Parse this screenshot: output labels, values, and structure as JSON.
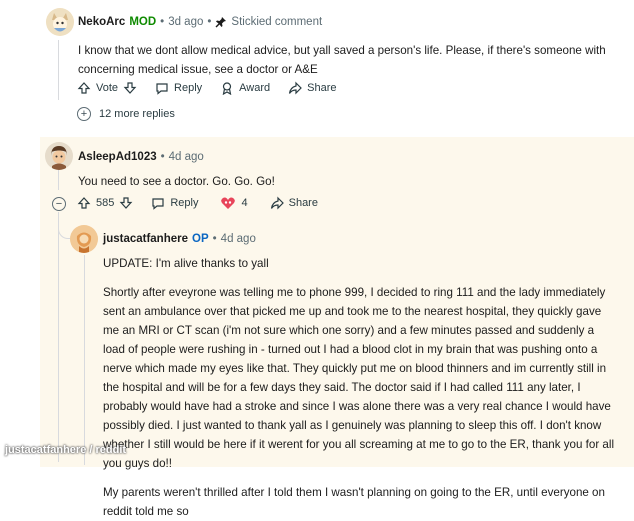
{
  "comments": [
    {
      "user": "NekoArc",
      "badge": "MOD",
      "time": "3d ago",
      "stickied": "Stickied comment",
      "text": "I know that we dont allow medical advice, but yall saved a person's life. Please, if there's someone with concerning medical issue, see a doctor or A&E",
      "actions": {
        "vote": "Vote",
        "reply": "Reply",
        "award": "Award",
        "share": "Share"
      },
      "more_replies": "12 more replies"
    },
    {
      "user": "AsleepAd1023",
      "time": "4d ago",
      "text": "You need to see a doctor. Go. Go. Go!",
      "actions": {
        "score": "585",
        "reply": "Reply",
        "award_count": "4",
        "share": "Share"
      }
    },
    {
      "user": "justacatfanhere",
      "badge": "OP",
      "time": "4d ago",
      "paragraphs": [
        "UPDATE: I'm alive thanks to yall",
        "Shortly after eveyrone was telling me to phone 999, I decided to ring 111 and the lady immediately sent an ambulance over that picked me up and took me to the nearest hospital, they quickly gave me an MRI or CT scan (i'm not sure which one sorry) and a few minutes passed and suddenly a load of people were rushing in - turned out I had a blood clot in my brain that was pushing onto a nerve which made my eyes like that. They quickly put me on blood thinners and im currently still in the hospital and will be for a few days they said. The doctor said if I had called 111 any later, I probably would have had a stroke and since I was alone there was a very real chance I would have possibly died. I just wanted to thank yall as I genuinely was planning to sleep this off. I don't know whether I still would be here if it werent for you all screaming at me to go to the ER, thank you for all you guys do!!",
        "My parents weren't thrilled after I told them I wasn't planning on going to the ER, until everyone on reddit told me so"
      ]
    }
  ],
  "watermark": "justacatfanhere / reddit"
}
